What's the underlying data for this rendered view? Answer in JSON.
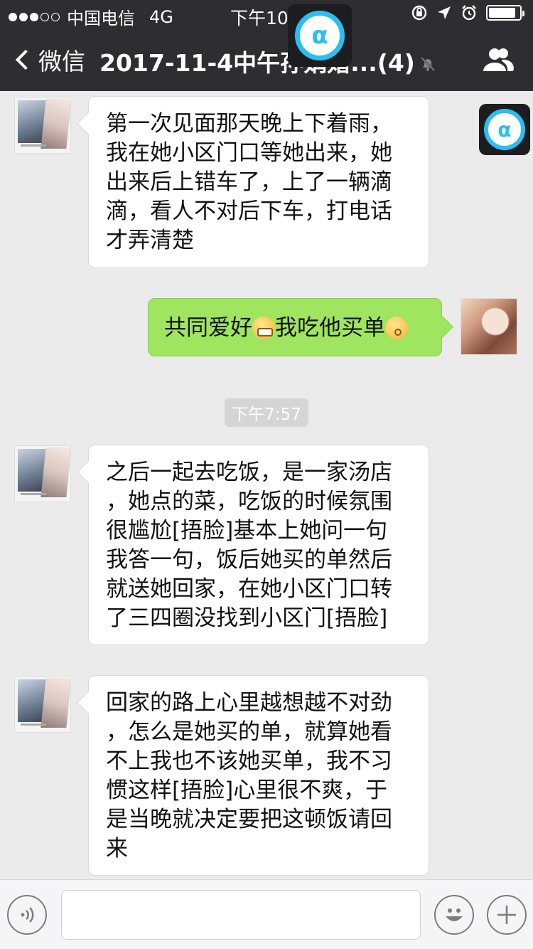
{
  "status": {
    "carrier": "中国电信",
    "network": "4G",
    "time": "下午10:17"
  },
  "nav": {
    "back_label": "微信",
    "title": "2017-11-4中午孙娟婚...(4)"
  },
  "overlay_icons": {
    "glyph": "α",
    "accent": "#2bbef0"
  },
  "messages": [
    {
      "side": "left",
      "lines": [
        "第一次见面那天晚上下着雨，",
        "我在她小区门口等她出来，她",
        "出来后上错车了，上了一辆滴",
        "滴，看人不对后下车，打电话",
        "才弄清楚"
      ]
    },
    {
      "side": "right",
      "text_a": "共同爱好",
      "emoji_a": "grimacing-emoji",
      "text_b": "我吃他买单",
      "emoji_b": "kissing-emoji"
    },
    {
      "side": "left",
      "lines": [
        "之后一起去吃饭，是一家汤店",
        "，她点的菜，吃饭的时候氛围",
        "很尴尬[捂脸]基本上她问一句",
        "我答一句，饭后她买的单然后",
        "就送她回家，在她小区门口转",
        "了三四圈没找到小区门[捂脸]"
      ]
    },
    {
      "side": "left",
      "lines": [
        "回家的路上心里越想越不对劲",
        "，怎么是她买的单，就算她看",
        "不上我也不该她买单，我不习",
        "惯这样[捂脸]心里很不爽，于",
        "是当晚就决定要把这顿饭请回",
        "来"
      ]
    }
  ],
  "timestamp": "下午7:57",
  "colors": {
    "header_bg": "#2e2e32",
    "chat_bg": "#ebebeb",
    "sent_bubble": "#9fe55f",
    "received_bubble": "#ffffff"
  }
}
